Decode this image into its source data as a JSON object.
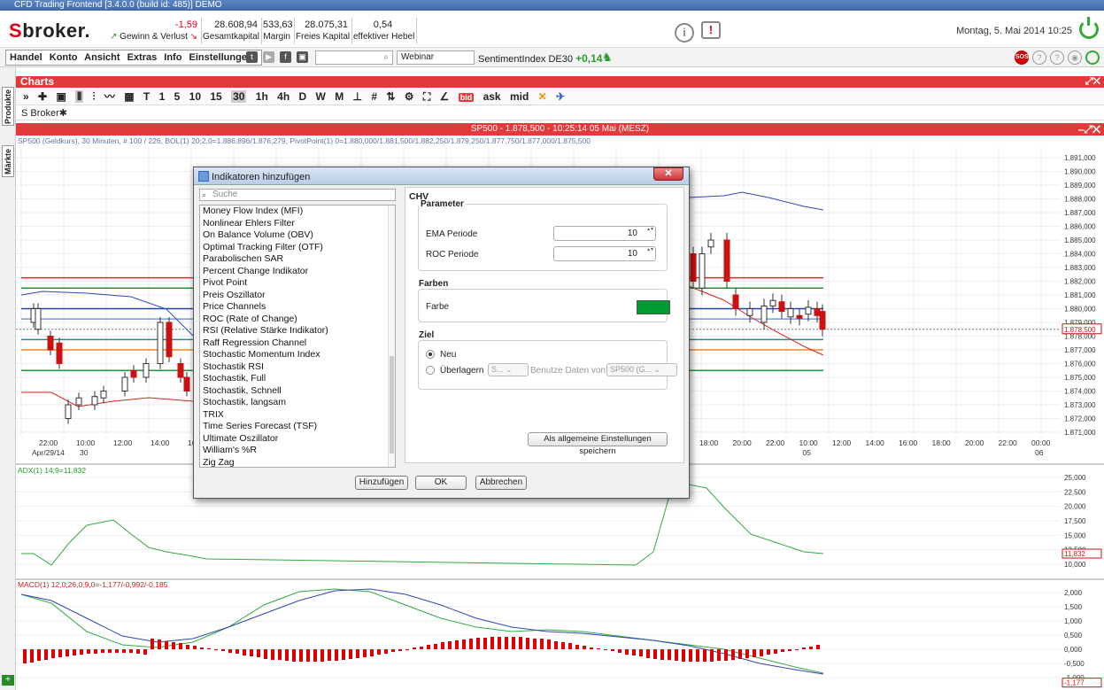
{
  "window": {
    "title": "CFD Trading Frontend [3.4.0.0 (build id: 485)] DEMO"
  },
  "header": {
    "logo_s": "S",
    "logo_text": "broker.",
    "kpis": [
      {
        "value": "-1,59",
        "label": "Gewinn & Verlust"
      },
      {
        "value": "28.608,94",
        "label": "Gesamtkapital"
      },
      {
        "value": "533,63",
        "label": "Margin"
      },
      {
        "value": "28.075,31",
        "label": "Freies Kapital"
      },
      {
        "value": "0,54",
        "label": "effektiver Hebel"
      }
    ],
    "date": "Montag, 5. Mai 2014 10:25"
  },
  "menu": {
    "items": [
      "Handel",
      "Konto",
      "Ansicht",
      "Extras",
      "Info",
      "Einstellungen"
    ],
    "webinar": "Webinar",
    "sentiment_label": "SentimentIndex DE30",
    "sentiment_value": "+0,14",
    "sos": "SOS"
  },
  "sidebar": {
    "produkte": "Produkte",
    "maerkte": "Märkte"
  },
  "charts": {
    "header": "Charts",
    "toolbar_timeframes": [
      "T",
      "1",
      "5",
      "10",
      "15",
      "30",
      "1h",
      "4h",
      "D",
      "W",
      "M"
    ],
    "toolbar_selected": "30",
    "toolbar_prices": [
      "bid",
      "ask",
      "mid"
    ],
    "tab": "S Broker",
    "chart_title": "SP500 - 1.878,500 - 10:25:14 05 Mai (MESZ)",
    "indicator_line": "SP500 (Geldkurs), 30 Minuten, # 100 / 226, BOL(1) 20;2,0=1.886,896/1.876,279, PivotPoint(1) 0=1.880,000/1.881,500/1.882,250/1.879,250/1.877,750/1.877,000/1.875,500",
    "adx_label": "ADX(1) 14;9=11,832",
    "macd_label": "MACD(1) 12,0;26,0;9,0=-1,177/-0,992/-0,185",
    "price_ticks": [
      "1.891,000",
      "1.890,000",
      "1.889,000",
      "1.888,000",
      "1.887,000",
      "1.886,000",
      "1.885,000",
      "1.884,000",
      "1.883,000",
      "1.882,000",
      "1.881,000",
      "1.880,000",
      "1.879,000",
      "1.878,000",
      "1.877,000",
      "1.876,000",
      "1.875,000",
      "1.874,000",
      "1.873,000",
      "1.872,000",
      "1.871,000"
    ],
    "price_marker": "1.878,500",
    "adx_ticks": [
      "25,000",
      "22,500",
      "20,000",
      "17,500",
      "15,000",
      "12,500",
      "10,000"
    ],
    "adx_marker": "11,832",
    "macd_ticks": [
      "2,000",
      "1,500",
      "1,000",
      "0,500",
      "0,000",
      "-0,500",
      "-1,000"
    ],
    "macd_marker": "-1,177",
    "time_ticks_left": [
      {
        "t": "22:00",
        "d": "Apr/29/14"
      },
      {
        "t": "10:00",
        "d": "30"
      },
      {
        "t": "12:00",
        "d": ""
      },
      {
        "t": "14:00",
        "d": ""
      },
      {
        "t": "16",
        "d": ""
      }
    ],
    "time_ticks_right": [
      {
        "t": "18:00",
        "d": ""
      },
      {
        "t": "20:00",
        "d": ""
      },
      {
        "t": "22:00",
        "d": ""
      },
      {
        "t": "10:00",
        "d": "05"
      },
      {
        "t": "12:00",
        "d": ""
      },
      {
        "t": "14:00",
        "d": ""
      },
      {
        "t": "16:00",
        "d": ""
      },
      {
        "t": "18:00",
        "d": ""
      },
      {
        "t": "20:00",
        "d": ""
      },
      {
        "t": "22:00",
        "d": ""
      },
      {
        "t": "00:00",
        "d": "06"
      }
    ],
    "colors": {
      "pivot_red": "#e8262a",
      "pivot_green": "#1a9a3a",
      "pivot_blue": "#2244aa",
      "pivot_teal": "#2a8a8a",
      "pivot_orange": "#ee8822",
      "boll_upper": "#3344bb",
      "boll_lower": "#dd2222",
      "adx": "#33aa44",
      "macd": "#3344bb",
      "signal": "#33aa44",
      "histogram": "#dd0000"
    }
  },
  "dialog": {
    "title": "Indikatoren hinzufügen",
    "search_placeholder": "Suche",
    "indicators": [
      "Money Flow Index (MFI)",
      "Nonlinear Ehlers Filter",
      "On Balance Volume (OBV)",
      "Optimal Tracking Filter (OTF)",
      "Parabolischen SAR",
      "Percent Change Indikator",
      "Pivot Point",
      "Preis Oszillator",
      "Price Channels",
      "ROC (Rate of Change)",
      "RSI (Relative Stärke Indikator)",
      "Raff Regression Channel",
      "Stochastic Momentum Index",
      "Stochastik RSI",
      "Stochastik, Full",
      "Stochastik, Schnell",
      "Stochastik, langsam",
      "TRIX",
      "Time Series Forecast (TSF)",
      "Ultimate Oszillator",
      "William's %R",
      "Zig Zag"
    ],
    "selected_title": "CHV",
    "param_title": "Parameter",
    "ema_label": "EMA Periode",
    "ema_value": "10",
    "roc_label": "ROC Periode",
    "roc_value": "10",
    "colors_title": "Farben",
    "color_label": "Farbe",
    "color_value": "#009933",
    "target_title": "Ziel",
    "target_new": "Neu",
    "target_overlay": "Überlagern",
    "overlay_select": "S...",
    "use_data_label": "Benutze Daten von",
    "use_data_select": "SP500 (G...",
    "save_defaults": "Als allgemeine Einstellungen speichern",
    "add": "Hinzufügen",
    "ok": "OK",
    "cancel": "Abbrechen"
  }
}
